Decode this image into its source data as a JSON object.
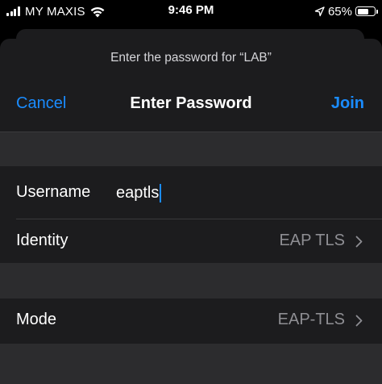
{
  "status_bar": {
    "carrier": "MY MAXIS",
    "time": "9:46 PM",
    "battery_percent": "65%",
    "battery_level": 0.65,
    "icons": [
      "cellular-signal-icon",
      "wifi-icon",
      "location-arrow-icon",
      "battery-icon"
    ]
  },
  "sheet": {
    "prompt": "Enter the password for “LAB”",
    "title": "Enter Password",
    "cancel_label": "Cancel",
    "join_label": "Join"
  },
  "form": {
    "username": {
      "label": "Username",
      "value": "eaptls"
    },
    "identity": {
      "label": "Identity",
      "value": "EAP TLS"
    },
    "mode": {
      "label": "Mode",
      "value": "EAP-TLS"
    }
  },
  "colors": {
    "accent": "#1a8cff",
    "background": "#000000",
    "sheet": "#1c1c1e",
    "separator": "#3a3a3c",
    "secondary_text": "#8e8e93"
  }
}
